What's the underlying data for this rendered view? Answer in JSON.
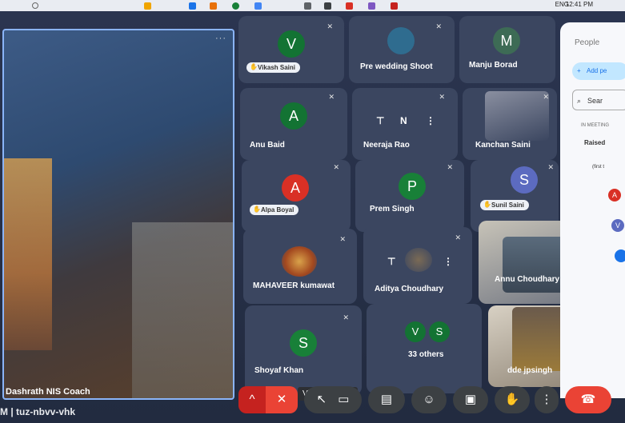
{
  "taskbar": {
    "language": "ENG",
    "time": "12:41 PM"
  },
  "main_tile": {
    "name": "Dashrath NIS Coach",
    "menu": "···"
  },
  "participants": [
    {
      "initial": "V",
      "name": "Vikash Saini",
      "color": "#137333",
      "raised": true
    },
    {
      "name": "Pre wedding Shoot"
    },
    {
      "initial": "M",
      "name": "Manju Borad",
      "color": "#0b8043"
    },
    {
      "initial": "A",
      "name": "Anu Baid",
      "color": "#137333"
    },
    {
      "name": "Neeraja Rao",
      "pin_label": "N"
    },
    {
      "name": "Kanchan Saini"
    },
    {
      "initial": "A",
      "name": "Alpa Boyal",
      "color": "#d93025",
      "raised": true
    },
    {
      "initial": "P",
      "name": "Prem Singh",
      "color": "#188038"
    },
    {
      "initial": "S",
      "name": "Sunil Saini",
      "color": "#5c6bc0",
      "raised": true
    },
    {
      "name": "MAHAVEER kumawat"
    },
    {
      "name": "Aditya Choudhary"
    },
    {
      "name": "Annu Choudhary"
    },
    {
      "initial": "S",
      "name": "Shoyaf Khan",
      "color": "#188038"
    },
    {
      "name": "33 others",
      "initials": [
        "V",
        "S"
      ]
    },
    {
      "name": "dde jpsingh"
    }
  ],
  "people_panel": {
    "title": "People",
    "add_label": "Add pe",
    "search_placeholder": "Sear",
    "section": "IN MEETING",
    "raised_label": "Raised",
    "first_label": "(first t",
    "avatars": [
      {
        "initial": "A",
        "color": "#d93025"
      },
      {
        "initial": "V",
        "color": "#5c6bc0"
      },
      {
        "initial": "",
        "color": "#1a73e8"
      }
    ]
  },
  "tooltip": "Video settings",
  "meeting_code": "M | tuz-nbvv-vhk",
  "controls": {
    "more_options": "^",
    "mic": "mic off",
    "video": "video",
    "captions": "captions",
    "emoji": "emoji",
    "present": "present",
    "raise_hand": "raise hand",
    "more": "⋮",
    "leave": "leave call"
  }
}
